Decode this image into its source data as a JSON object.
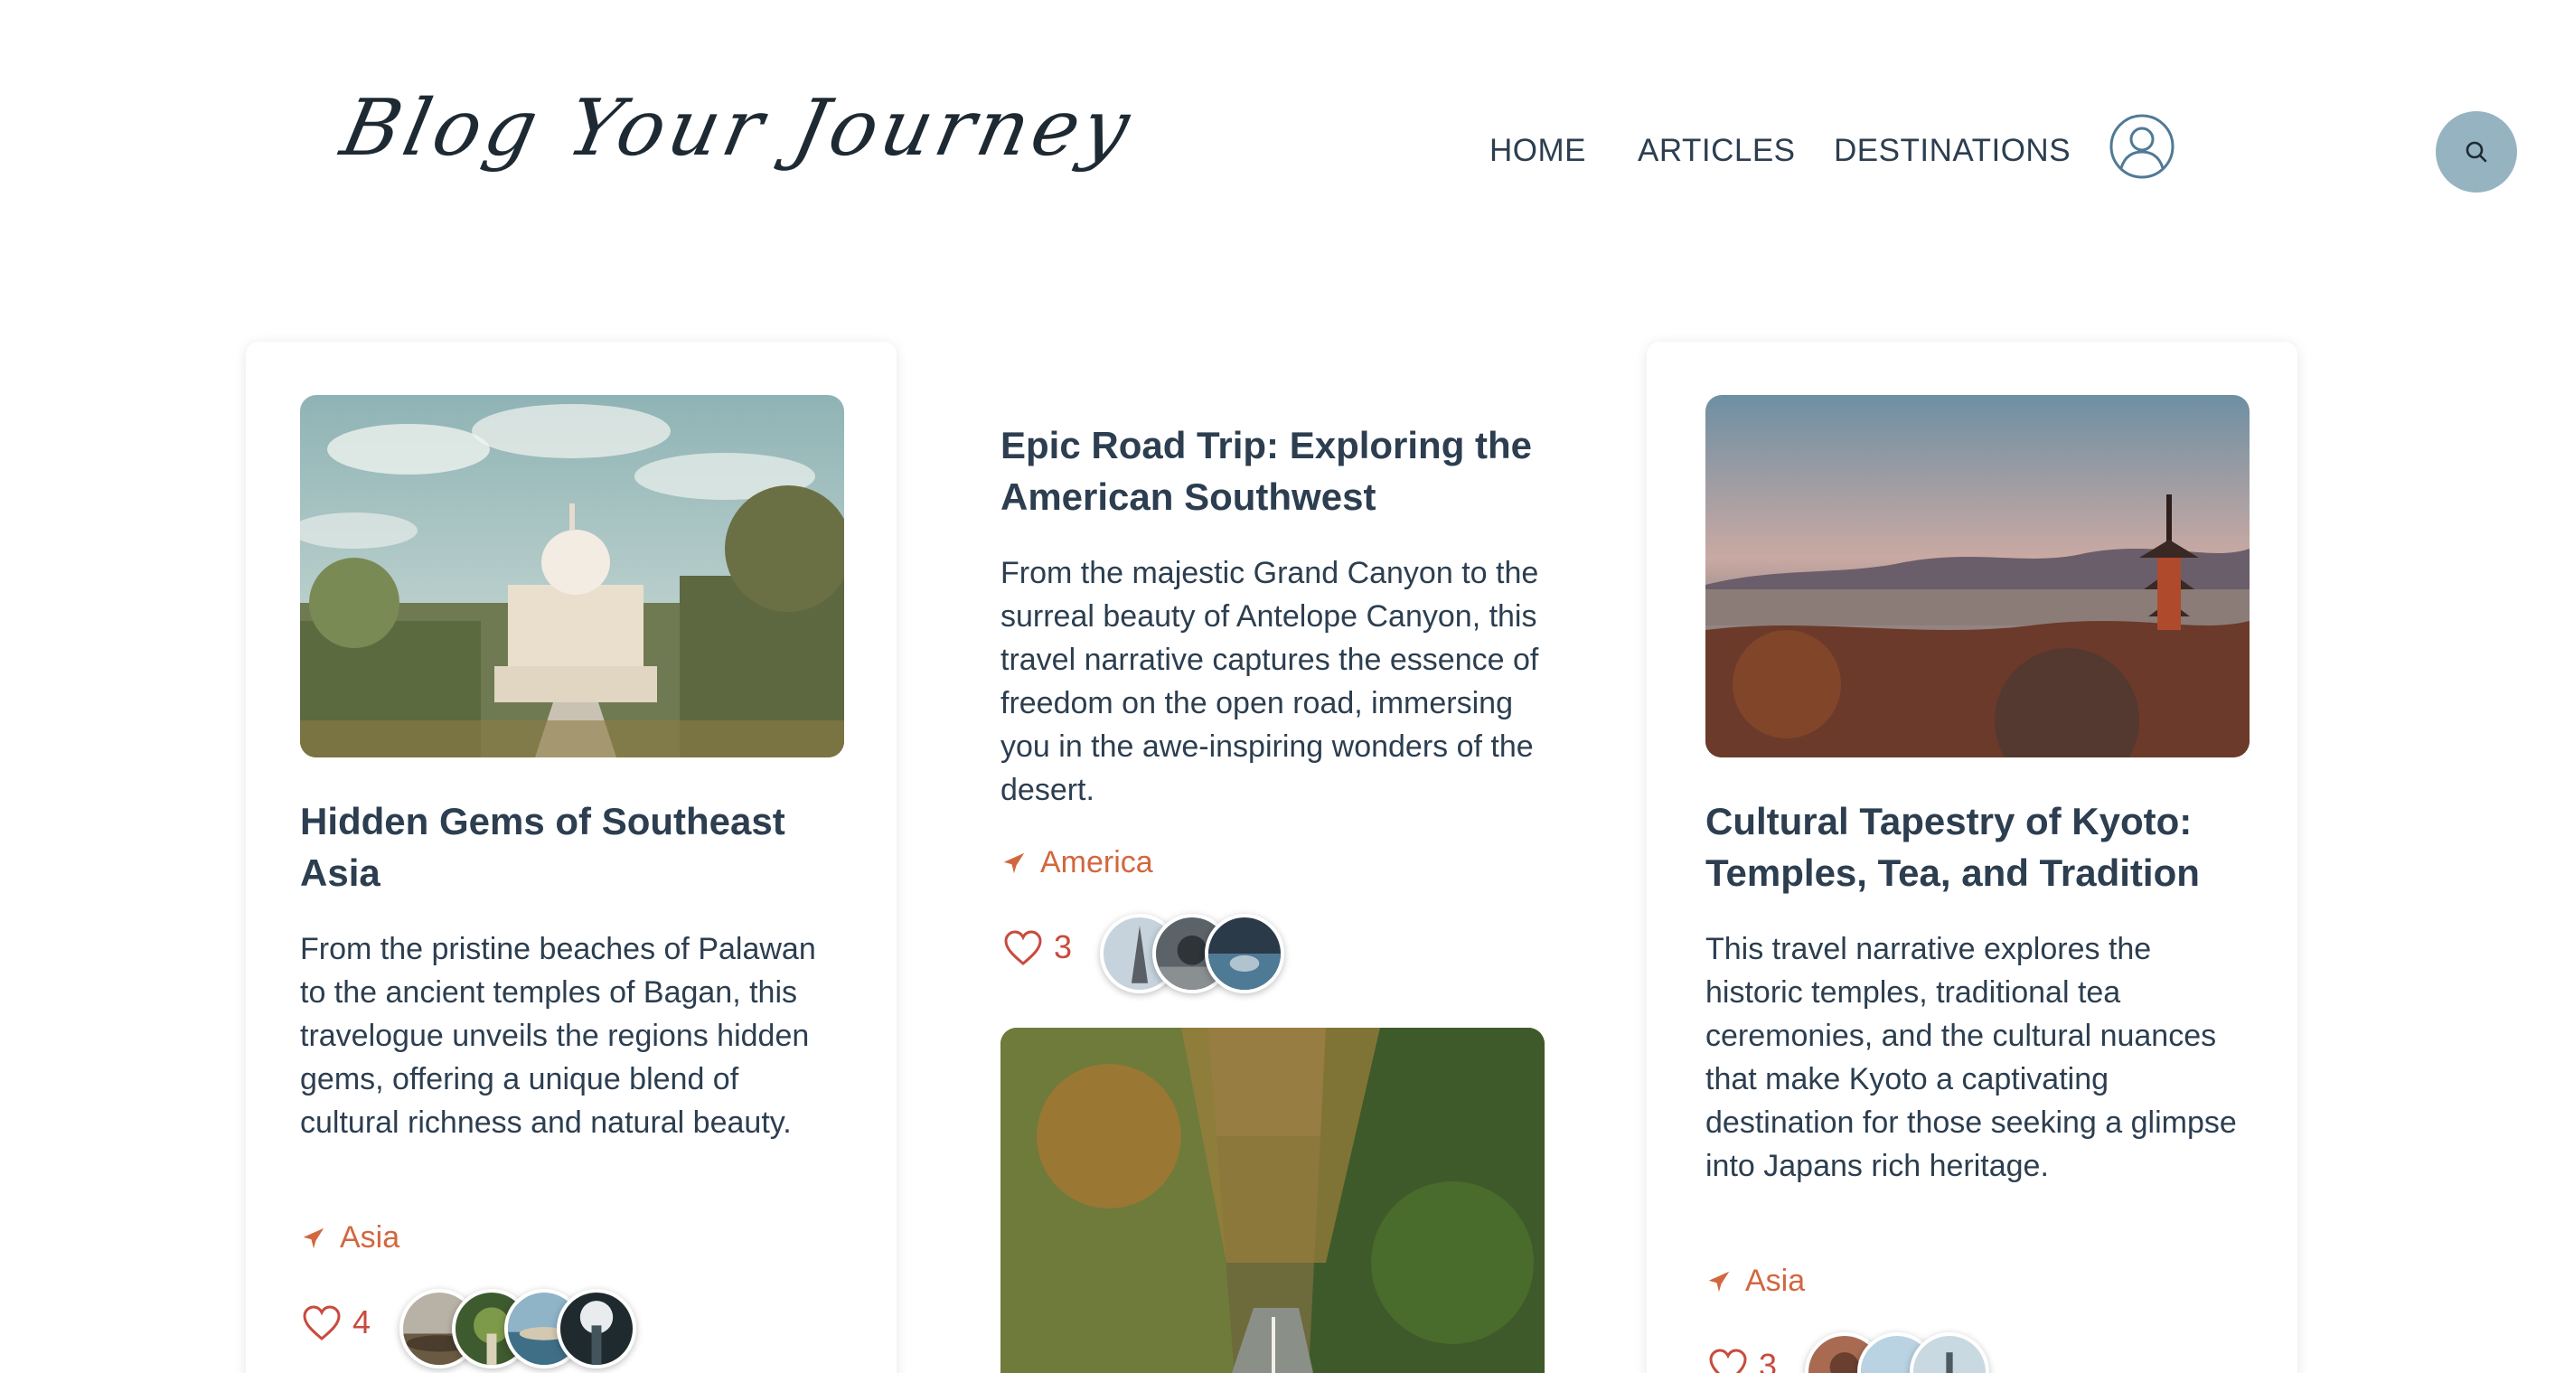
{
  "header": {
    "logo": "Blog Your Journey",
    "nav": {
      "home": "HOME",
      "articles": "ARTICLES",
      "destinations": "DESTINATIONS"
    },
    "user_icon": "user-circle-icon",
    "search_icon": "search-icon"
  },
  "colors": {
    "accent_orange": "#d2673f",
    "heart_red": "#c84b3e",
    "text_dark": "#2c3e50",
    "search_bg": "#96b3c1"
  },
  "articles": [
    {
      "image": "taj-like-mausoleum-garden-photo",
      "title": "Hidden Gems of Southeast Asia",
      "description": "From the pristine beaches of Palawan to the ancient temples of Bagan, this travelogue unveils the regions hidden gems, offering a unique blend of cultural richness and natural beauty.",
      "destination": "Asia",
      "likes": "4"
    },
    {
      "title": "Epic Road Trip: Exploring the American Southwest",
      "description": "From the majestic Grand Canyon to the surreal beauty of Antelope Canyon, this travel narrative captures the essence of freedom on the open road, immersing you in the awe-inspiring wonders of the desert.",
      "destination": "America",
      "likes": "3",
      "image": "forest-road-photo"
    },
    {
      "image": "kyoto-pagoda-sunset-photo",
      "title": "Cultural Tapestry of Kyoto: Temples, Tea, and Tradition",
      "description": "This travel narrative explores the historic temples, traditional tea ceremonies, and the cultural nuances that make Kyoto a captivating destination for those seeking a glimpse into Japans rich heritage.",
      "destination": "Asia",
      "likes": "3"
    }
  ],
  "icons": {
    "tag": "airplane-icon",
    "like": "heart-icon"
  }
}
